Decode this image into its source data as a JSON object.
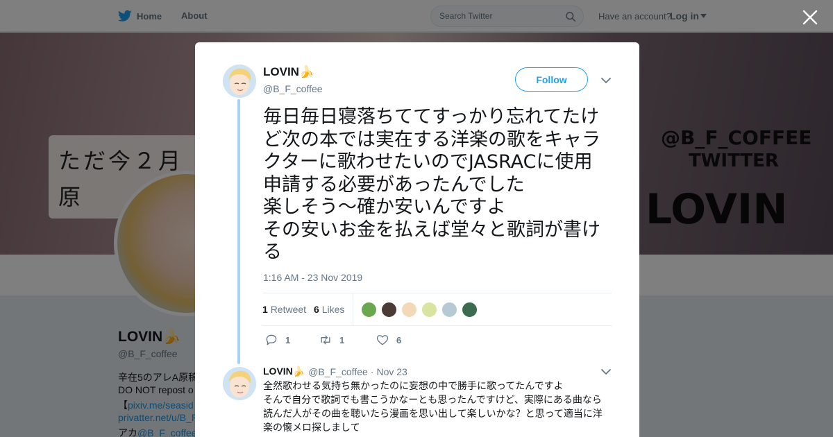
{
  "topbar": {
    "home_label": "Home",
    "about_label": "About",
    "search_placeholder": "Search Twitter",
    "have_account": "Have an account?",
    "login_label": "Log in",
    "brand_color": "#1da1f2"
  },
  "background_profile": {
    "banner_card_lines": [
      "ただ今２月",
      "原"
    ],
    "banner_right_lines": [
      "@B_F_COFFEE",
      "TWITTER",
      "LOVIN"
    ],
    "name": "LOVIN🍌",
    "handle": "@B_F_coffee",
    "bio_lines": [
      {
        "text": "辛在5のアレA原稿",
        "link": ""
      },
      {
        "text": "DO NOT repost o",
        "link": ""
      },
      {
        "text": "【",
        "link": "pixiv.me/seasid"
      },
      {
        "text": "",
        "link": "privatter.net/u/B_F"
      },
      {
        "text": "アカ",
        "link": "@B_F_coffee"
      }
    ]
  },
  "modal": {
    "close_icon": "close-icon",
    "tweet": {
      "author_name": "LOVIN🍌",
      "author_handle": "@B_F_coffee",
      "follow_label": "Follow",
      "text_lines": [
        "毎日毎日寝落ちててすっかり忘れてたけ",
        "ど次の本では実在する洋楽の歌をキャラ",
        "クターに歌わせたいのでJASRACに使用",
        "申請する必要があったんでした",
        "楽しそう〜確か安いんですよ",
        "その安いお金を払えば堂々と歌詞が書け",
        "る"
      ],
      "timestamp": "1:16 AM - 23 Nov 2019",
      "retweet_count": "1",
      "retweet_label": "Retweet",
      "like_count": "6",
      "like_label": "Likes",
      "liker_colors": [
        "#6aa84f",
        "#4a3c35",
        "#f3d9b8",
        "#d8e4a0",
        "#b8c9d6",
        "#3d6b4f"
      ],
      "actions": {
        "reply_count": "1",
        "retweet_count": "1",
        "like_count": "6"
      }
    },
    "reply": {
      "author_name": "LOVIN🍌",
      "author_handle": "@B_F_coffee",
      "separator": "·",
      "date": "Nov 23",
      "text_lines": [
        "全然歌わせる気持ち無かったのに妄想の中で勝手に歌ってたんですよ",
        "そんで自分で歌詞でも書こうかなーとも思ったんですけど、実際にある曲なら",
        "読んだ人がその曲を聴いたら漫画を思い出して楽しいかな？と思って適当に洋",
        "楽の懐メロ探しまして"
      ]
    }
  }
}
